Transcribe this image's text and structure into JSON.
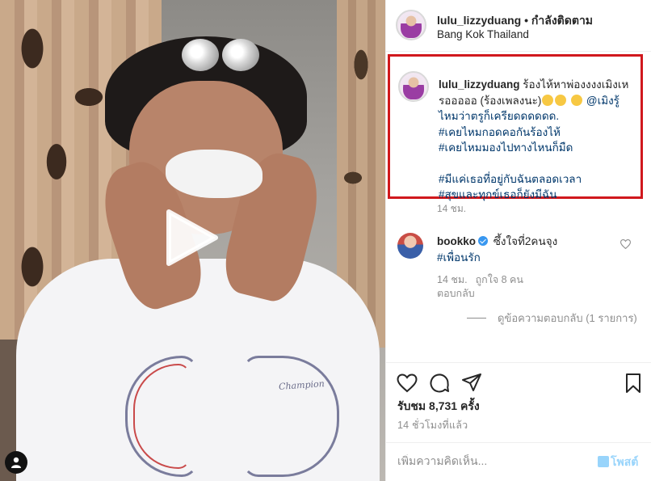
{
  "post": {
    "username": "lulu_lizzyduang",
    "follow_status": " • กำลังติดตาม",
    "location": "Bang Kok Thailand"
  },
  "caption": {
    "username": "lulu_lizzyduang",
    "line1": " ร้องไห้หาพ่องงงงเมิงเหรอออออ (ร้องเพลงนะ)",
    "line2_mention": "@เมิงรู้ไหมว่าตรูก็เครียดดดดดด.",
    "hashtags": [
      "#เคยไหมกอดคอกันร้องไห้",
      "#เคยไหมมองไปทางไหนก็มืด"
    ],
    "hashtags2": [
      "#มีแค่เธอที่อยู่กับฉันตลอดเวลา",
      "#สุขและทุกข์เธอก็ยังมีฉัน"
    ],
    "time": "14 ชม."
  },
  "comment": {
    "username": "bookko",
    "text": " ซึ้งใจที่2คนจุง",
    "hashtag": "#เพื่อนรัก",
    "time": "14 ชม.",
    "likes": "ถูกใจ 8 คน",
    "reply": "ตอบกลับ",
    "view_replies": "ดูข้อความตอบกลับ (1 รายการ)"
  },
  "stats": {
    "views": "รับชม 8,731 ครั้ง",
    "posted": "14 ชั่วโมงที่แล้ว"
  },
  "compose": {
    "placeholder": "เพิ่มความคิดเห็น...",
    "post_label": "โพสต์"
  },
  "icons": {
    "like": "heart-icon",
    "comment": "comment-icon",
    "share": "share-icon",
    "save": "bookmark-icon",
    "play": "play-icon",
    "user": "user-tag-icon"
  },
  "colors": {
    "highlight_border": "#d0181d",
    "link": "#00376b",
    "verified": "#3897f0",
    "post_button": "#0095f6"
  }
}
